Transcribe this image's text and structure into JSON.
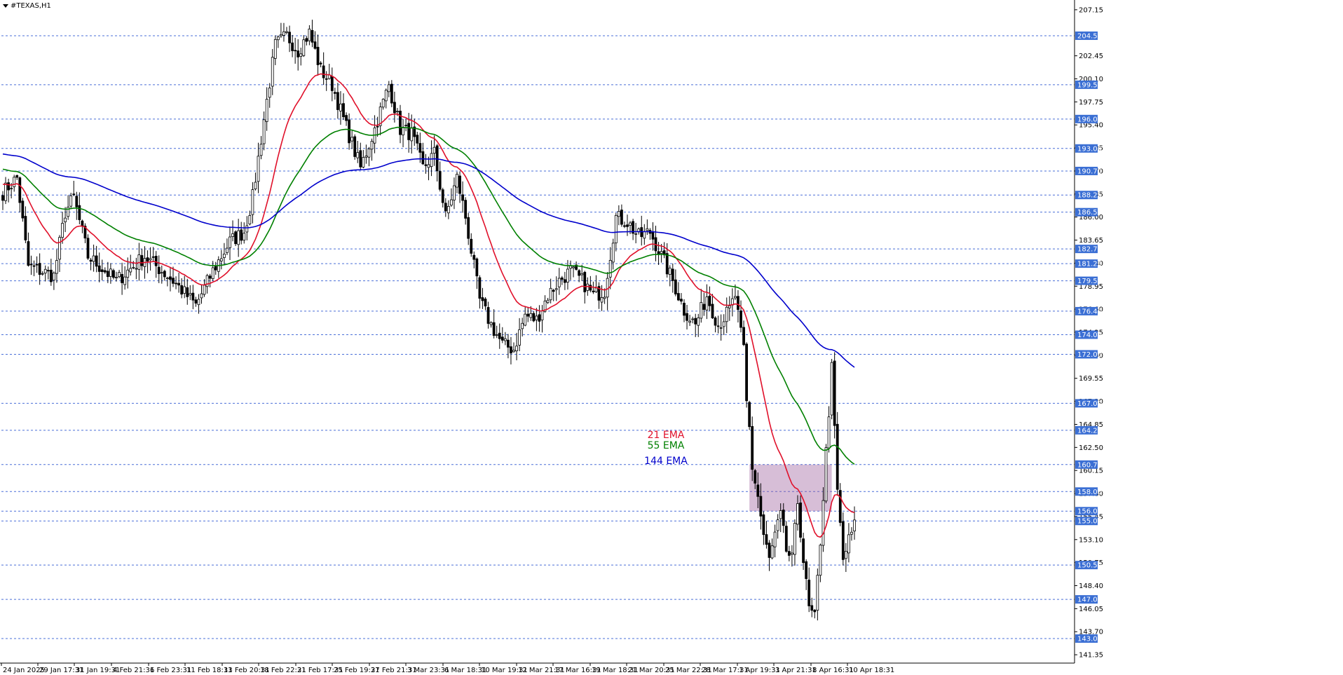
{
  "chart_data": {
    "type": "line",
    "title": "#TEXAS,H1",
    "ylim": [
      140.5,
      208.0
    ],
    "x_ticks": [
      "24 Jan 2025",
      "29 Jan 17:31",
      "31 Jan 19:31",
      "4 Feb 21:31",
      "6 Feb 23:31",
      "11 Feb 18:31",
      "13 Feb 20:31",
      "18 Feb 22:31",
      "21 Feb 17:31",
      "25 Feb 19:31",
      "27 Feb 21:31",
      "3 Mar 23:31",
      "6 Mar 18:31",
      "10 Mar 19:31",
      "12 Mar 21:31",
      "17 Mar 16:31",
      "19 Mar 18:31",
      "21 Mar 20:31",
      "25 Mar 22:31",
      "28 Mar 17:31",
      "1 Apr 19:31",
      "3 Apr 21:31",
      "8 Apr 16:31",
      "10 Apr 18:31"
    ],
    "y_ticks": [
      207.15,
      202.45,
      200.1,
      197.75,
      195.4,
      193.05,
      190.7,
      188.35,
      186.0,
      183.65,
      181.3,
      178.95,
      176.6,
      174.25,
      171.9,
      169.55,
      167.2,
      164.85,
      162.5,
      160.15,
      157.8,
      155.45,
      153.1,
      150.75,
      148.4,
      146.05,
      143.7,
      141.35
    ],
    "levels": [
      204.5,
      199.5,
      196.0,
      193.0,
      190.7,
      188.25,
      186.5,
      182.75,
      181.25,
      179.5,
      176.4,
      174.0,
      172.0,
      167.0,
      164.25,
      160.75,
      158.0,
      156.0,
      155.0,
      150.5,
      147.0,
      143.0
    ],
    "zone": {
      "from_bar": 263,
      "to_bar": 292,
      "high": 160.75,
      "low": 156.0
    },
    "series": [
      {
        "name": "21 EMA",
        "color": "#e0102a",
        "period": 21
      },
      {
        "name": "55 EMA",
        "color": "#008000",
        "period": 55
      },
      {
        "name": "144 EMA",
        "color": "#0000cc",
        "period": 144
      }
    ],
    "anchors": [
      [
        0,
        188.5
      ],
      [
        5,
        190.0
      ],
      [
        9,
        181.0
      ],
      [
        18,
        180.0
      ],
      [
        22,
        186.5
      ],
      [
        25,
        188.0
      ],
      [
        30,
        182.0
      ],
      [
        40,
        179.5
      ],
      [
        50,
        182.0
      ],
      [
        60,
        179.5
      ],
      [
        68,
        177.0
      ],
      [
        74,
        180.5
      ],
      [
        80,
        183.5
      ],
      [
        85,
        184.5
      ],
      [
        88,
        188.0
      ],
      [
        92,
        196.0
      ],
      [
        96,
        203.5
      ],
      [
        100,
        204.5
      ],
      [
        104,
        203.0
      ],
      [
        108,
        204.8
      ],
      [
        112,
        201.0
      ],
      [
        116,
        199.5
      ],
      [
        120,
        196.0
      ],
      [
        126,
        191.0
      ],
      [
        131,
        195.0
      ],
      [
        136,
        199.5
      ],
      [
        140,
        195.0
      ],
      [
        144,
        194.5
      ],
      [
        148,
        191.0
      ],
      [
        152,
        192.5
      ],
      [
        156,
        186.0
      ],
      [
        160,
        190.0
      ],
      [
        163,
        186.0
      ],
      [
        168,
        177.5
      ],
      [
        172,
        175.0
      ],
      [
        176,
        173.0
      ],
      [
        180,
        172.5
      ],
      [
        184,
        176.0
      ],
      [
        188,
        175.5
      ],
      [
        192,
        178.0
      ],
      [
        196,
        179.5
      ],
      [
        200,
        180.5
      ],
      [
        204,
        179.5
      ],
      [
        208,
        178.0
      ],
      [
        212,
        178.5
      ],
      [
        216,
        186.0
      ],
      [
        220,
        185.5
      ],
      [
        224,
        184.0
      ],
      [
        228,
        184.5
      ],
      [
        232,
        182.0
      ],
      [
        236,
        179.5
      ],
      [
        240,
        176.5
      ],
      [
        244,
        175.0
      ],
      [
        248,
        178.0
      ],
      [
        252,
        175.0
      ],
      [
        256,
        176.5
      ],
      [
        258,
        178.0
      ],
      [
        260,
        174.0
      ],
      [
        261,
        172.5
      ],
      [
        262,
        167.0
      ],
      [
        263,
        164.5
      ],
      [
        264,
        160.5
      ],
      [
        266,
        157.5
      ],
      [
        268,
        153.5
      ],
      [
        270,
        151.0
      ],
      [
        272,
        153.5
      ],
      [
        274,
        155.5
      ],
      [
        276,
        152.0
      ],
      [
        278,
        151.0
      ],
      [
        280,
        157.0
      ],
      [
        282,
        151.0
      ],
      [
        284,
        146.0
      ],
      [
        286,
        145.0
      ],
      [
        288,
        153.0
      ],
      [
        290,
        162.0
      ],
      [
        292,
        170.5
      ],
      [
        294,
        158.0
      ],
      [
        296,
        151.0
      ],
      [
        298,
        153.0
      ],
      [
        300,
        154.5
      ]
    ],
    "annotations": [
      "21 EMA",
      "55 EMA",
      "144 EMA"
    ]
  }
}
